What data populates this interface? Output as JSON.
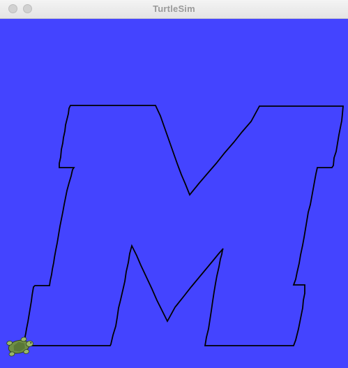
{
  "window": {
    "title": "TurtleSim"
  },
  "canvas": {
    "background_color": "#4444ff",
    "pen_color": "#000000"
  },
  "turtle": {
    "icon": "turtle-icon",
    "color": "#6f8f45"
  }
}
